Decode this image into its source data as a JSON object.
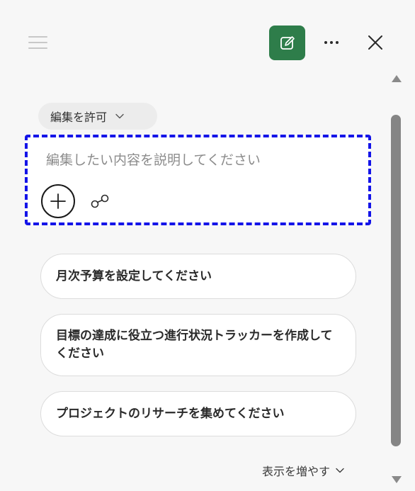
{
  "header": {
    "menu_icon": "hamburger-menu-icon",
    "new_icon": "compose-edit-icon",
    "more_icon": "more-horizontal-icon",
    "close_icon": "close-icon",
    "accent_color": "#2e7d4a"
  },
  "permission": {
    "label": "編集を許可",
    "icon": "chevron-down-icon"
  },
  "composer": {
    "placeholder": "編集したい内容を説明してください",
    "add_icon": "plus-icon",
    "link_icon": "link-icon"
  },
  "suggestions": [
    "月次予算を設定してください",
    "目標の達成に役立つ進行状況トラッカーを作成してください",
    "プロジェクトのリサーチを集めてください"
  ],
  "show_more": {
    "label": "表示を増やす",
    "icon": "chevron-down-icon"
  }
}
